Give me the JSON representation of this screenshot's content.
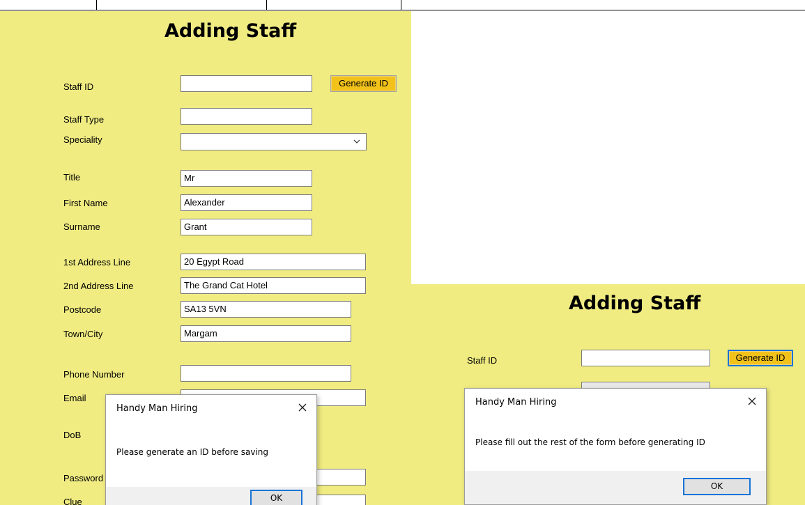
{
  "left_form": {
    "title": "Adding Staff",
    "generate_button": "Generate ID",
    "labels": {
      "staff_id": "Staff ID",
      "staff_type": "Staff Type",
      "speciality": "Speciality",
      "title": "Title",
      "first_name": "First Name",
      "surname": "Surname",
      "address1": "1st Address Line",
      "address2": "2nd Address Line",
      "postcode": "Postcode",
      "town": "Town/City",
      "phone": "Phone Number",
      "email": "Email",
      "dob": "DoB",
      "password": "Password",
      "clue": "Clue"
    },
    "values": {
      "staff_id": "",
      "staff_type": "",
      "speciality": "",
      "title": "Mr",
      "first_name": "Alexander",
      "surname": "Grant",
      "address1": "20 Egypt Road",
      "address2": "The Grand Cat Hotel",
      "postcode": "SA13 5VN",
      "town": "Margam",
      "phone": "",
      "email": "",
      "password": "",
      "clue": ""
    },
    "dialog": {
      "title": "Handy Man Hiring",
      "message": "Please generate an ID before saving",
      "ok": "OK"
    }
  },
  "right_form": {
    "title": "Adding Staff",
    "generate_button": "Generate ID",
    "labels": {
      "staff_id": "Staff ID"
    },
    "values": {
      "staff_id": ""
    },
    "dialog": {
      "title": "Handy Man Hiring",
      "message": "Please fill out the rest of the form before generating ID",
      "ok": "OK"
    }
  },
  "colors": {
    "form_background": "#f0ec82",
    "generate_button": "#f2c21b",
    "focus_border": "#1874d6"
  },
  "icons": {
    "dropdown": "chevron-down-icon",
    "close": "close-icon"
  }
}
